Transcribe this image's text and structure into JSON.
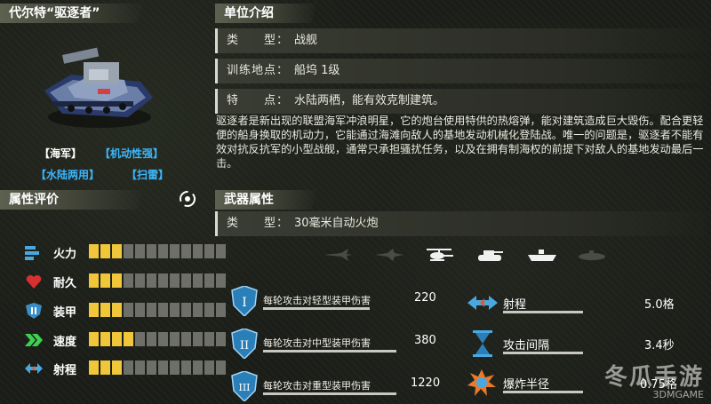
{
  "unit": {
    "name": "代尔特“驱逐者”",
    "tags": [
      "【海军】",
      "【机动性强】",
      "【水陆两用】",
      "【扫雷】"
    ]
  },
  "intro": {
    "header": "单位介绍",
    "type_key": "类　　型：",
    "type_val": "战舰",
    "place_key": "训练地点：",
    "place_val": "船坞 1级",
    "feature_key": "特　　点：",
    "feature_val": "水陆两栖，能有效克制建筑。",
    "description": "驱逐者是新出现的联盟海军冲浪明星，它的炮台使用特供的热熔弹，能对建筑造成巨大毁伤。配合更轻便的船身换取的机动力，它能通过海滩向敌人的基地发动机械化登陆战。唯一的问题是，驱逐者不能有效对抗反抗军的小型战舰，通常只承担骚扰任务，以及在拥有制海权的前提下对敌人的基地发动最后一击。"
  },
  "attributes": {
    "header": "属性评价",
    "items": [
      {
        "label": "火力",
        "icon": "firepower-icon",
        "level": 3,
        "max": 12
      },
      {
        "label": "耐久",
        "icon": "heart-icon",
        "level": 3,
        "max": 12
      },
      {
        "label": "装甲",
        "icon": "armor-icon",
        "level": 3,
        "max": 12
      },
      {
        "label": "速度",
        "icon": "speed-icon",
        "level": 4,
        "max": 12
      },
      {
        "label": "射程",
        "icon": "range-icon",
        "level": 3,
        "max": 12
      }
    ]
  },
  "weapon": {
    "header": "武器属性",
    "type_key": "类　　型：",
    "type_val": "30毫米自动火炮",
    "targets": [
      "jet-icon",
      "plane-icon",
      "helicopter-icon",
      "tank-icon",
      "ship-icon",
      "submarine-icon"
    ],
    "active_target": "helicopter-icon",
    "damage": [
      {
        "label": "每轮攻击对轻型装甲伤害",
        "value": "220",
        "icon": "armor-light-icon"
      },
      {
        "label": "每轮攻击对中型装甲伤害",
        "value": "380",
        "icon": "armor-medium-icon"
      },
      {
        "label": "每轮攻击对重型装甲伤害",
        "value": "1220",
        "icon": "armor-heavy-icon"
      }
    ],
    "props": [
      {
        "label": "射程",
        "value": "5.0格",
        "icon": "range-icon"
      },
      {
        "label": "攻击间隔",
        "value": "3.4秒",
        "icon": "hourglass-icon"
      },
      {
        "label": "爆炸半径",
        "value": "0.75格",
        "icon": "explosion-icon"
      }
    ]
  },
  "watermark": {
    "text": "冬瓜手游",
    "sub": "3DMGAME"
  },
  "colors": {
    "accent": "#f0c63a",
    "blue": "#3ab7ff",
    "bar_off": "#6f6f6a"
  }
}
